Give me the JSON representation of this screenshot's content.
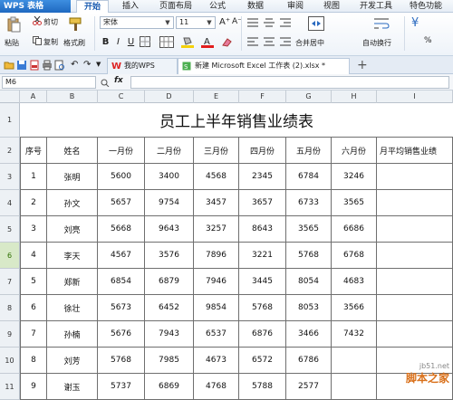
{
  "app": {
    "name": "WPS 表格"
  },
  "ribbon": {
    "tabs": [
      "开始",
      "插入",
      "页面布局",
      "公式",
      "数据",
      "审阅",
      "视图",
      "开发工具",
      "特色功能"
    ],
    "active_tab": "开始"
  },
  "toolbar": {
    "paste": "粘贴",
    "cut": "剪切",
    "copy": "复制",
    "format_painter": "格式刷",
    "font_name": "宋体",
    "font_size": "11",
    "bold": "B",
    "italic": "I",
    "underline": "U",
    "merge_center": "合并居中",
    "wrap_text": "自动换行",
    "currency": "¥"
  },
  "doc_tabs": {
    "home": "我的WPS",
    "file": "新建 Microsoft Excel 工作表 (2).xlsx *"
  },
  "formula_bar": {
    "name_box": "M6",
    "fx": "fx",
    "value": ""
  },
  "sheet": {
    "columns": [
      "A",
      "B",
      "C",
      "D",
      "E",
      "F",
      "G",
      "H",
      "I"
    ],
    "row_numbers": [
      "1",
      "2",
      "3",
      "4",
      "5",
      "6",
      "7",
      "8",
      "9",
      "10",
      "11"
    ],
    "title": "员工上半年销售业绩表",
    "headers": [
      "序号",
      "姓名",
      "一月份",
      "二月份",
      "三月份",
      "四月份",
      "五月份",
      "六月份",
      "月平均销售业绩"
    ],
    "rows": [
      [
        "1",
        "张明",
        "5600",
        "3400",
        "4568",
        "2345",
        "6784",
        "3246",
        ""
      ],
      [
        "2",
        "孙文",
        "5657",
        "9754",
        "3457",
        "3657",
        "6733",
        "3565",
        ""
      ],
      [
        "3",
        "刘亮",
        "5668",
        "9643",
        "3257",
        "8643",
        "3565",
        "6686",
        ""
      ],
      [
        "4",
        "李天",
        "4567",
        "3576",
        "7896",
        "3221",
        "5768",
        "6768",
        ""
      ],
      [
        "5",
        "郑新",
        "6854",
        "6879",
        "7946",
        "3445",
        "8054",
        "4683",
        ""
      ],
      [
        "6",
        "徐壮",
        "5673",
        "6452",
        "9854",
        "5768",
        "8053",
        "3566",
        ""
      ],
      [
        "7",
        "孙楠",
        "5676",
        "7943",
        "6537",
        "6876",
        "3466",
        "7432",
        ""
      ],
      [
        "8",
        "刘芳",
        "5768",
        "7985",
        "4673",
        "6572",
        "6786",
        "",
        ""
      ],
      [
        "9",
        "谢玉",
        "5737",
        "6869",
        "4768",
        "5788",
        "2577",
        "",
        ""
      ]
    ]
  },
  "watermark": {
    "site": "jb51.net",
    "name": "脚本之家"
  },
  "colors": {
    "accent": "#1f69c0",
    "selected_row": "#d8e9c8"
  }
}
